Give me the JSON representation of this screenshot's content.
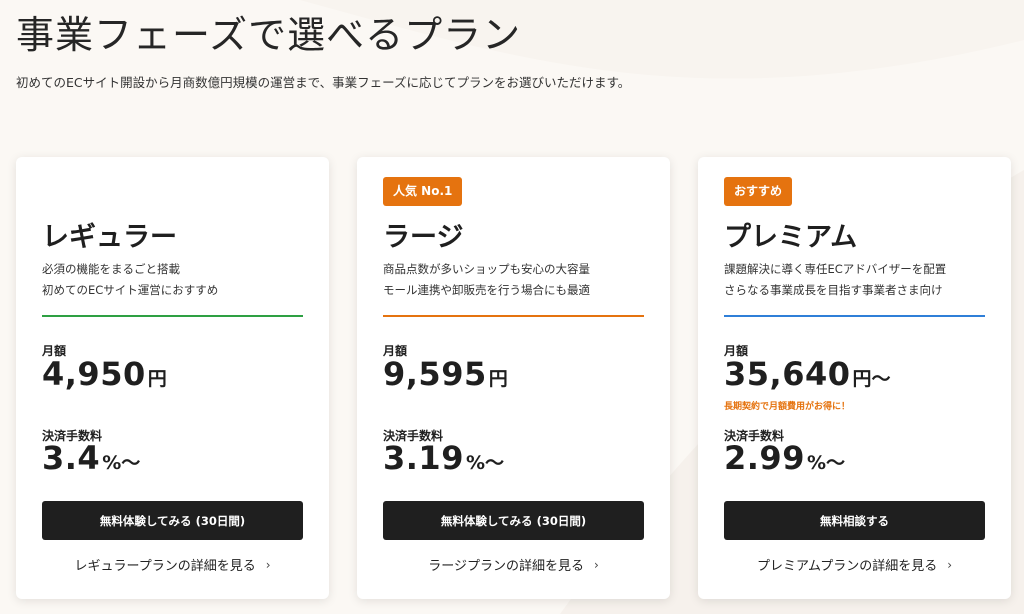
{
  "header": {
    "title": "事業フェーズで選べるプラン",
    "subtitle": "初めてのECサイト開設から月商数億円規模の運営まで、事業フェーズに応じてプランをお選びいただけます。"
  },
  "colors": {
    "badge": "#e5730f",
    "regular_line": "#2ea043",
    "large_line": "#e5730f",
    "premium_line": "#2f7fd8",
    "cta_bg": "#1f1f1f",
    "note": "#e5730f"
  },
  "plans": [
    {
      "badge": "",
      "name": "レギュラー",
      "desc": [
        "必須の機能をまるごと搭載",
        "初めてのECサイト運営におすすめ"
      ],
      "monthly_label": "月額",
      "monthly_price": "4,950",
      "monthly_unit": "円",
      "monthly_note": "",
      "fee_label": "決済手数料",
      "fee_value": "3.4",
      "fee_unit": "%〜",
      "cta": "無料体験してみる (30日間)",
      "link": "レギュラープランの詳細を見る",
      "chevron_icon": "chevron-right-icon"
    },
    {
      "badge": "人気 No.1",
      "name": "ラージ",
      "desc": [
        "商品点数が多いショップも安心の大容量",
        "モール連携や卸販売を行う場合にも最適"
      ],
      "monthly_label": "月額",
      "monthly_price": "9,595",
      "monthly_unit": "円",
      "monthly_note": "",
      "fee_label": "決済手数料",
      "fee_value": "3.19",
      "fee_unit": "%〜",
      "cta": "無料体験してみる (30日間)",
      "link": "ラージプランの詳細を見る",
      "chevron_icon": "chevron-right-icon"
    },
    {
      "badge": "おすすめ",
      "name": "プレミアム",
      "desc": [
        "課題解決に導く専任ECアドバイザーを配置",
        "さらなる事業成長を目指す事業者さま向け"
      ],
      "monthly_label": "月額",
      "monthly_price": "35,640",
      "monthly_unit": "円〜",
      "monthly_note": "長期契約で月額費用がお得に！",
      "fee_label": "決済手数料",
      "fee_value": "2.99",
      "fee_unit": "%〜",
      "cta": "無料相談する",
      "link": "プレミアムプランの詳細を見る",
      "chevron_icon": "chevron-right-icon"
    }
  ]
}
